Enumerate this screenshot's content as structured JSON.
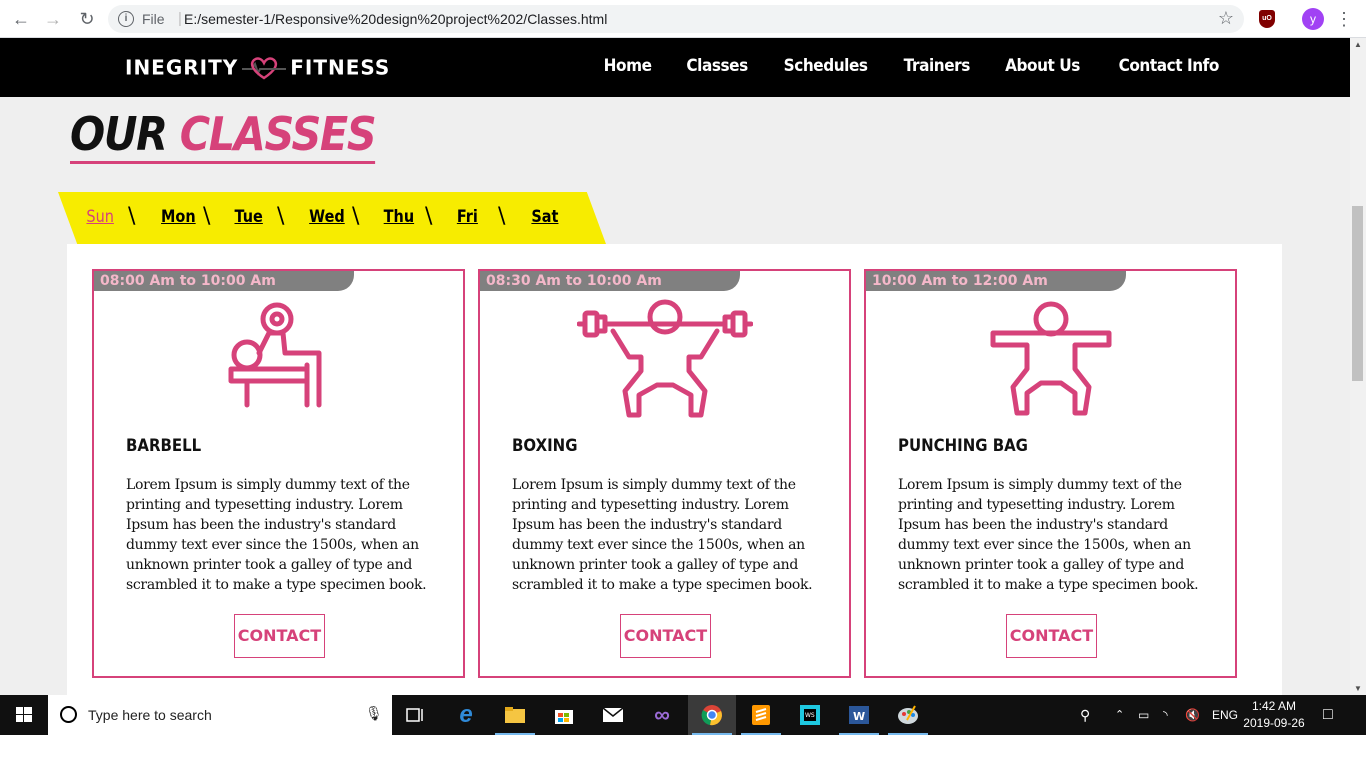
{
  "browser": {
    "scheme_label": "File",
    "url": "E:/semester-1/Responsive%20design%20project%202/Classes.html",
    "profile_initial": "y"
  },
  "site": {
    "logo_left": "INEGRITY",
    "logo_right": "FITNESS",
    "nav": [
      "Home",
      "Classes",
      "Schedules",
      "Trainers",
      "About Us",
      "Contact Info"
    ]
  },
  "page": {
    "title_word1": "OUR",
    "title_word2": "CLASSES",
    "days": [
      "Sun",
      "Mon",
      "Tue",
      "Wed",
      "Thu",
      "Fri",
      "Sat"
    ],
    "active_day": "Sun"
  },
  "classes": [
    {
      "time": "08:00 Am to 10:00 Am",
      "icon": "bench-press-icon",
      "title": "BARBELL",
      "description": "Lorem Ipsum is simply dummy text of the printing and typesetting industry. Lorem Ipsum has been the industry's standard dummy text ever since the 1500s, when an unknown printer took a galley of type and scrambled it to make a type specimen book.",
      "button": "CONTACT"
    },
    {
      "time": "08:30 Am to 10:00 Am",
      "icon": "weightlifter-icon",
      "title": "BOXING",
      "description": "Lorem Ipsum is simply dummy text of the printing and typesetting industry. Lorem Ipsum has been the industry's standard dummy text ever since the 1500s, when an unknown printer took a galley of type and scrambled it to make a type specimen book.",
      "button": "CONTACT"
    },
    {
      "time": "10:00 Am to 12:00 Am",
      "icon": "squat-icon",
      "title": "PUNCHING BAG",
      "description": "Lorem Ipsum is simply dummy text of the printing and typesetting industry. Lorem Ipsum has been the industry's standard dummy text ever since the 1500s, when an unknown printer took a galley of type and scrambled it to make a type specimen book.",
      "button": "CONTACT"
    }
  ],
  "taskbar": {
    "search_placeholder": "Type here to search",
    "language": "ENG",
    "time": "1:42 AM",
    "date": "2019-09-26"
  },
  "colors": {
    "accent": "#d6427a",
    "tabs_bg": "#f7ec00",
    "header_bg": "#000000",
    "time_badge_bg": "#808080"
  }
}
